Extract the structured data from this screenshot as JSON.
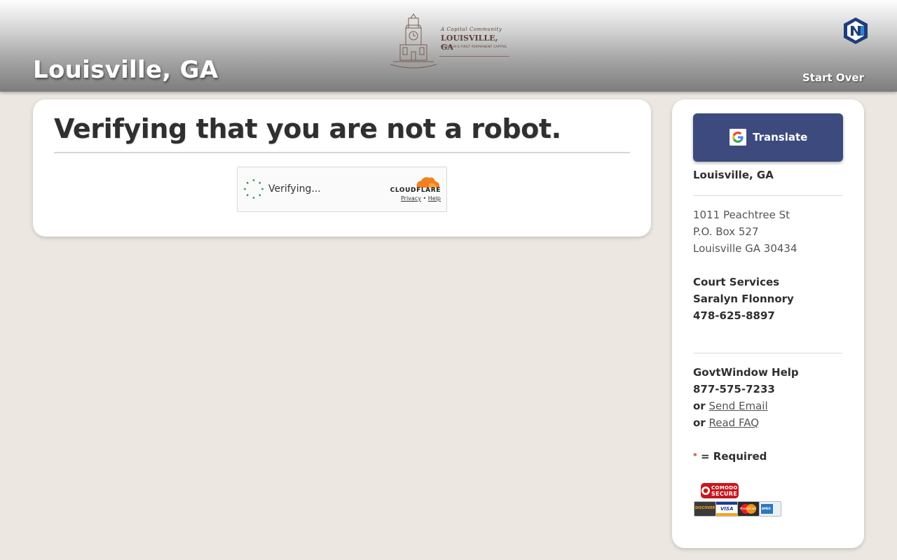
{
  "header": {
    "site_title": "Louisville, GA",
    "start_over_label": "Start Over",
    "seal": {
      "line1": "A Capital Community",
      "line2": "LOUISVILLE, GA",
      "line3": "GEORGIA'S FIRST PERMANENT CAPITAL"
    },
    "logo_icon": "govtwindow-logo-icon"
  },
  "main": {
    "heading": "Verifying that you are not a robot.",
    "captcha": {
      "status": "Verifying...",
      "brand": "CLOUDFLARE",
      "privacy_label": "Privacy",
      "separator": "•",
      "help_label": "Help"
    }
  },
  "sidebar": {
    "translate_label": "Translate",
    "office_name": "Louisville, GA",
    "address": {
      "street": "1011 Peachtree St",
      "po_box": "P.O. Box 527",
      "city_state_zip": "Louisville GA 30434"
    },
    "court": {
      "department": "Court Services",
      "contact_name": "Saralyn Flonnory",
      "phone": "478-625-8897"
    },
    "help": {
      "title": "GovtWindow Help",
      "phone": "877-575-7233",
      "or1": "or",
      "send_email_label": "Send Email",
      "or2": "or",
      "faq_label": "Read FAQ"
    },
    "required": {
      "star": "*",
      "label": "= Required"
    },
    "badges": {
      "secure_line1": "COMODO",
      "secure_line2": "SECURE",
      "cards": [
        "DISCOVER",
        "VISA",
        "MasterCard",
        "AMEX"
      ]
    }
  },
  "colors": {
    "page_bg": "#ece7e1",
    "translate_button": "#3c4a7e",
    "cloudflare_orange": "#f38020",
    "required_star": "#c0392b"
  }
}
